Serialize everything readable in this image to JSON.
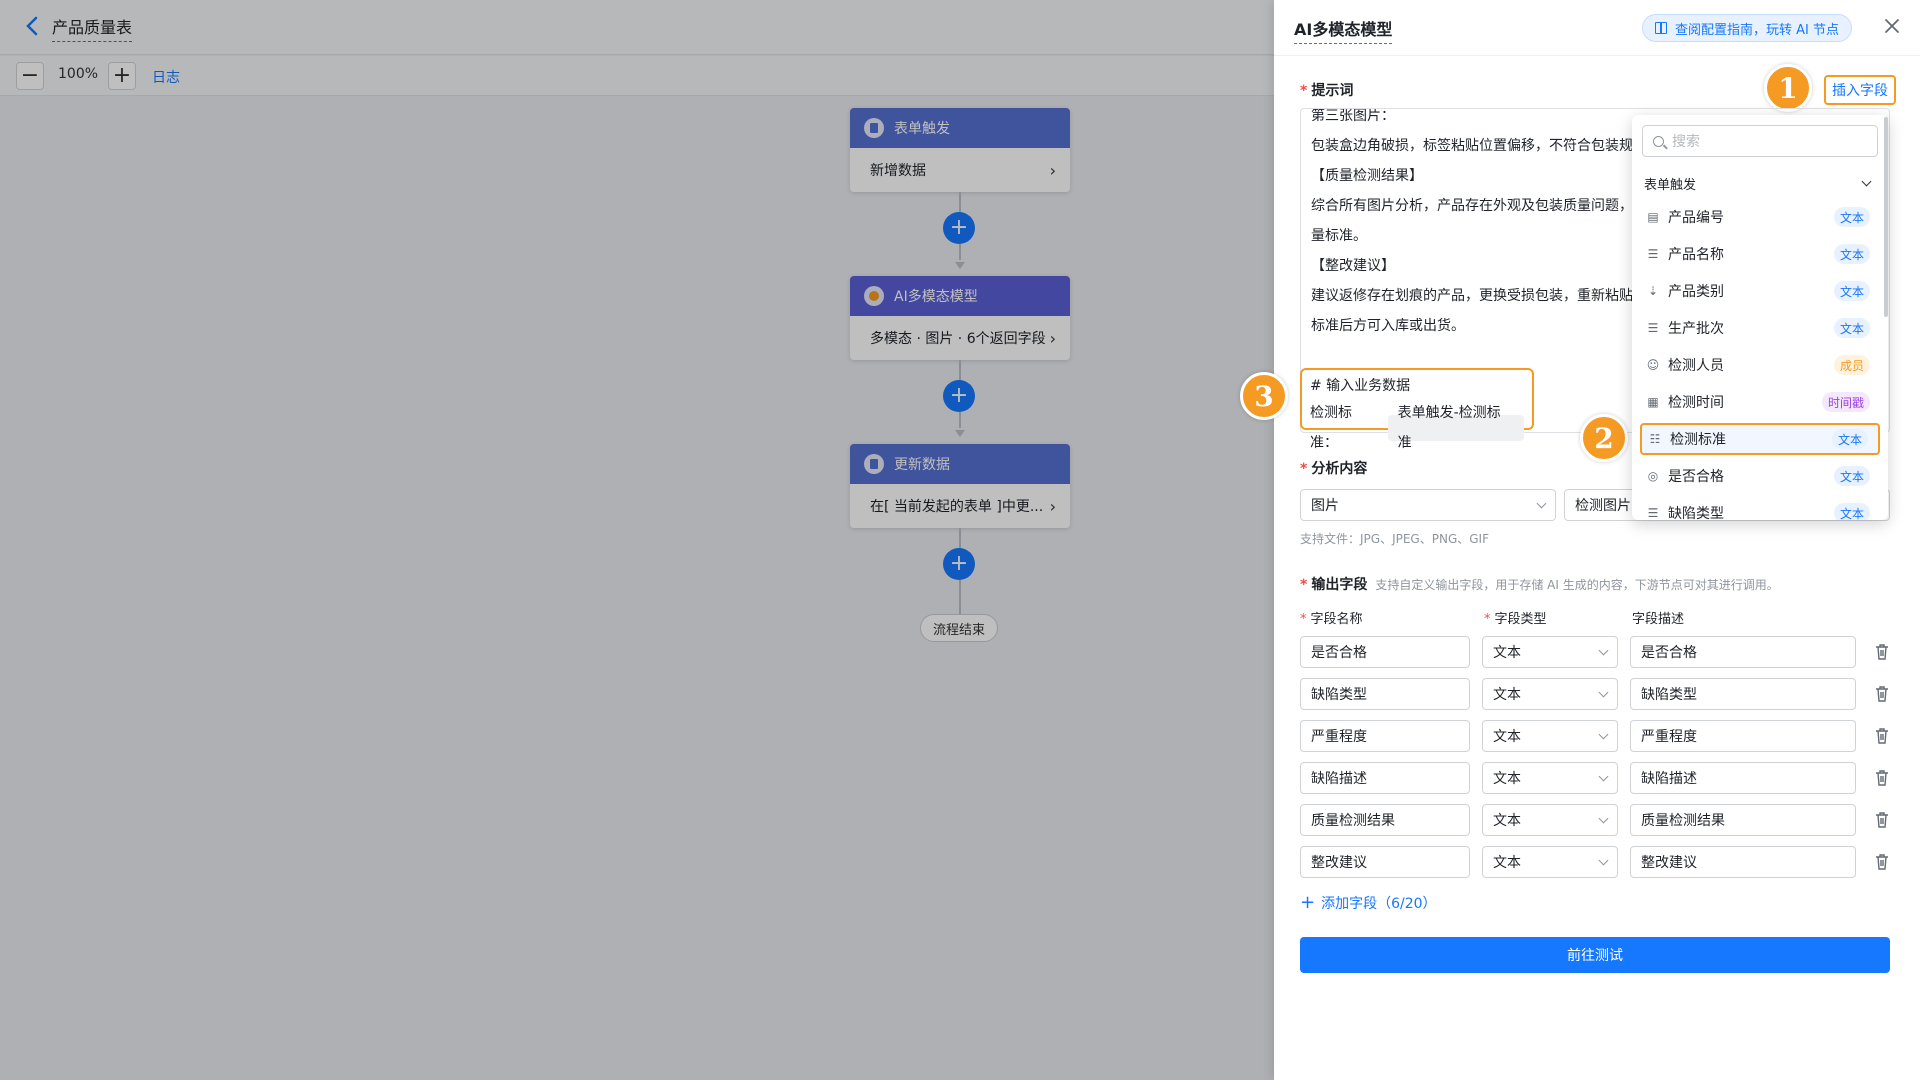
{
  "app": {
    "title": "产品质量表",
    "zoom": "100%",
    "log_label": "日志"
  },
  "flow": {
    "nodes": [
      {
        "title": "表单触发",
        "body": "新增数据",
        "color": "#5670d2"
      },
      {
        "title": "AI多模态模型",
        "body": "多模态 · 图片 · 6个返回字段",
        "color": "#5b5fd6"
      },
      {
        "title": "更新数据",
        "body": "在[ 当前发起的表单 ]中更...",
        "color": "#5670d2"
      }
    ],
    "end_label": "流程结束"
  },
  "panel": {
    "title": "AI多模态模型",
    "guide_label": "查阅配置指南，玩转 AI 节点",
    "prompt_label": "提示词",
    "insert_field_label": "插入字段",
    "prompt_lines": [
      "第三张图片：",
      "包装盒边角破损，标签粘贴位置偏移，不符合包装规",
      "【质量检测结果】",
      "综合所有图片分析，产品存在外观及包装质量问题，",
      "量标准。",
      "【整改建议】",
      "建议返修存在划痕的产品，更换受损包装，重新粘贴",
      "标准后方可入库或出货。"
    ],
    "biz_heading": "# 输入业务数据",
    "biz_label": "检测标准：",
    "biz_tag": "表单触发-检测标准",
    "analysis_label": "分析内容",
    "analysis_type": "图片",
    "analysis_source": "检测图片",
    "file_hint": "支持文件：JPG、JPEG、PNG、GIF",
    "output_label": "输出字段",
    "output_sub": "支持自定义输出字段，用于存储 AI 生成的内容，下游节点可对其进行调用。",
    "col_name": "字段名称",
    "col_type": "字段类型",
    "col_desc": "字段描述",
    "rows": [
      {
        "name": "是否合格",
        "type": "文本",
        "desc": "是否合格"
      },
      {
        "name": "缺陷类型",
        "type": "文本",
        "desc": "缺陷类型"
      },
      {
        "name": "严重程度",
        "type": "文本",
        "desc": "严重程度"
      },
      {
        "name": "缺陷描述",
        "type": "文本",
        "desc": "缺陷描述"
      },
      {
        "name": "质量检测结果",
        "type": "文本",
        "desc": "质量检测结果"
      },
      {
        "name": "整改建议",
        "type": "文本",
        "desc": "整改建议"
      }
    ],
    "add_field_label": "添加字段（6/20）",
    "go_test_label": "前往测试"
  },
  "dropdown": {
    "search_placeholder": "搜索",
    "group": "表单触发",
    "items": [
      {
        "label": "产品编号",
        "badge": "文本",
        "icon": "text-field-icon"
      },
      {
        "label": "产品名称",
        "badge": "文本",
        "icon": "lines-icon"
      },
      {
        "label": "产品类别",
        "badge": "文本",
        "icon": "sort-list-icon"
      },
      {
        "label": "生产批次",
        "badge": "文本",
        "icon": "lines-icon"
      },
      {
        "label": "检测人员",
        "badge": "成员",
        "icon": "person-icon"
      },
      {
        "label": "检测时间",
        "badge": "时间戳",
        "icon": "calendar-icon"
      },
      {
        "label": "检测标准",
        "badge": "文本",
        "icon": "checklist-icon",
        "selected": true
      },
      {
        "label": "是否合格",
        "badge": "文本",
        "icon": "radio-icon"
      },
      {
        "label": "缺陷类型",
        "badge": "文本",
        "icon": "lines-icon"
      }
    ]
  },
  "callouts": [
    "1",
    "2",
    "3"
  ],
  "colors": {
    "accent": "#1677ff",
    "highlight": "#f59a23"
  }
}
